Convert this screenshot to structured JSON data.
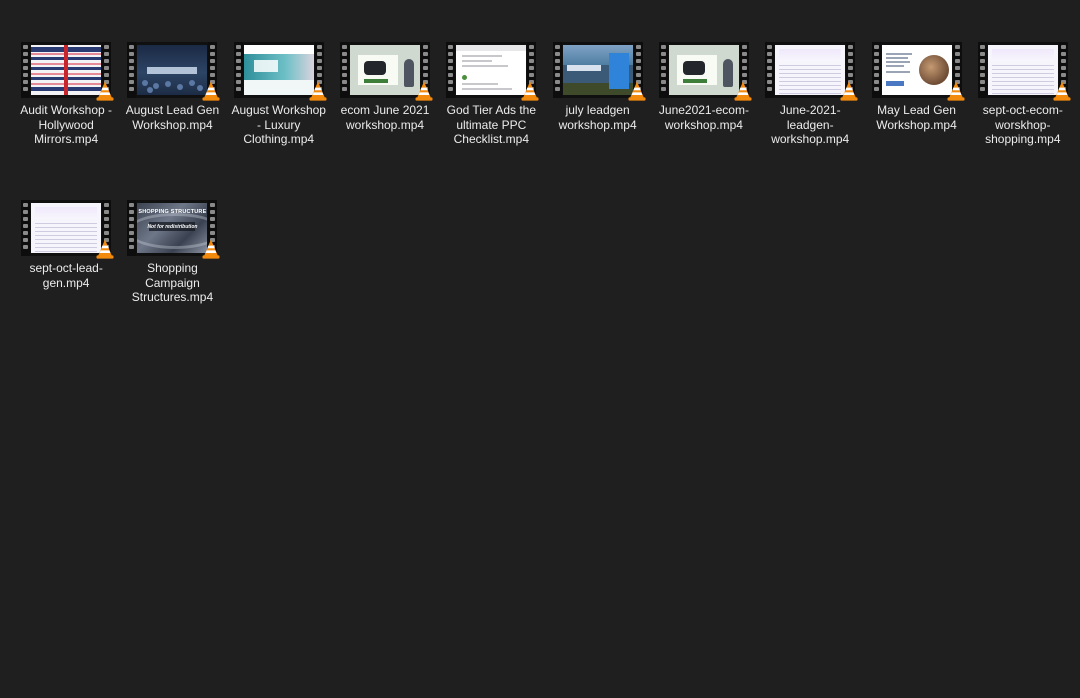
{
  "window": {
    "view": "large-icons",
    "background": "#1f1f1f",
    "label_color": "#ececec"
  },
  "files": [
    {
      "name": "Audit Workshop - Hollywood Mirrors.mp4",
      "thumbnail": "audit-table-frame",
      "icon": "vlc-cone-icon"
    },
    {
      "name": "August Lead Gen Workshop.mp4",
      "thumbnail": "conference-crowd-frame",
      "icon": "vlc-cone-icon"
    },
    {
      "name": "August Workshop - Luxury Clothing.mp4",
      "thumbnail": "website-hero-frame",
      "icon": "vlc-cone-icon"
    },
    {
      "name": "ecom June 2021 workshop.mp4",
      "thumbnail": "ecom-landing-frame",
      "icon": "vlc-cone-icon"
    },
    {
      "name": "God Tier Ads the ultimate PPC Checklist.mp4",
      "thumbnail": "document-frame",
      "icon": "vlc-cone-icon"
    },
    {
      "name": "july leadgen workshop.mp4",
      "thumbnail": "leadgen-landing-frame",
      "icon": "vlc-cone-icon"
    },
    {
      "name": "June2021-ecom-workshop.mp4",
      "thumbnail": "ecom-landing-frame",
      "icon": "vlc-cone-icon"
    },
    {
      "name": "June-2021-leadgen-workshop.mp4",
      "thumbnail": "spreadsheet-frame",
      "icon": "vlc-cone-icon"
    },
    {
      "name": "May Lead Gen Workshop.mp4",
      "thumbnail": "product-page-frame",
      "icon": "vlc-cone-icon"
    },
    {
      "name": "sept-oct-ecom-worskhop-shopping.mp4",
      "thumbnail": "spreadsheet-frame",
      "icon": "vlc-cone-icon"
    },
    {
      "name": "sept-oct-lead-gen.mp4",
      "thumbnail": "spreadsheet-frame",
      "icon": "vlc-cone-icon"
    },
    {
      "name": "Shopping Campaign Structures.mp4",
      "thumbnail": "title-slide-frame",
      "icon": "vlc-cone-icon",
      "thumbnail_text": {
        "title": "SHOPPING STRUCTURE",
        "subtitle": "Not for redistribution"
      }
    }
  ],
  "colors": {
    "vlc_orange": "#f28a0d",
    "vlc_white": "#ffffff",
    "film_strip": "#0d0d0d",
    "sprocket": "#8a8a8a"
  }
}
